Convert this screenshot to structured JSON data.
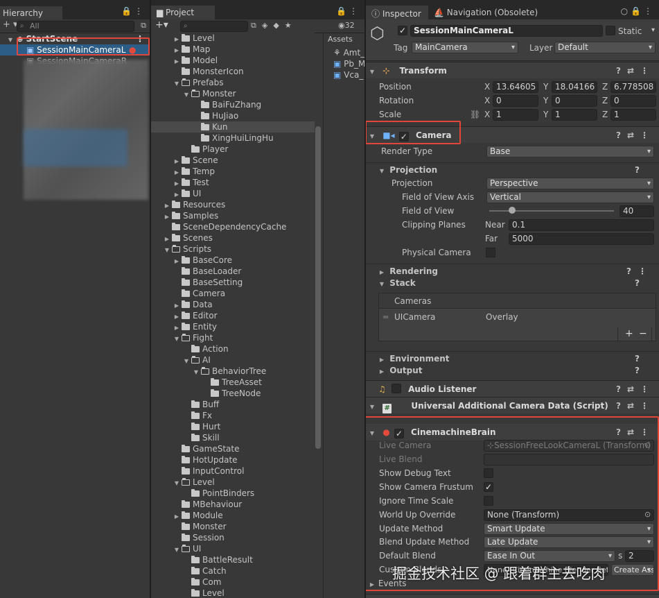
{
  "hierarchy": {
    "tab": "Hierarchy",
    "search_placeholder": "All",
    "scene": "StartScene",
    "selected": "SessionMainCameraL",
    "second": "SessionMainCameraR"
  },
  "project": {
    "tab": "Project",
    "count": "32",
    "assets_label": "Assets",
    "tree": [
      {
        "d": 2,
        "f": 1,
        "o": 0,
        "t": "Level"
      },
      {
        "d": 2,
        "f": 1,
        "o": 0,
        "t": "Map"
      },
      {
        "d": 2,
        "f": 1,
        "o": 0,
        "t": "Model"
      },
      {
        "d": 2,
        "f": 0,
        "o": 0,
        "t": "MonsterIcon"
      },
      {
        "d": 2,
        "f": 1,
        "o": 1,
        "t": "Prefabs"
      },
      {
        "d": 3,
        "f": 1,
        "o": 1,
        "t": "Monster"
      },
      {
        "d": 4,
        "f": 0,
        "o": 0,
        "t": "BaiFuZhang"
      },
      {
        "d": 4,
        "f": 0,
        "o": 0,
        "t": "HuJiao"
      },
      {
        "d": 4,
        "f": 0,
        "o": 0,
        "t": "Kun",
        "sel": 1
      },
      {
        "d": 4,
        "f": 0,
        "o": 0,
        "t": "XingHuiLingHu"
      },
      {
        "d": 3,
        "f": 0,
        "o": 0,
        "t": "Player"
      },
      {
        "d": 2,
        "f": 1,
        "o": 0,
        "t": "Scene"
      },
      {
        "d": 2,
        "f": 1,
        "o": 0,
        "t": "Temp"
      },
      {
        "d": 2,
        "f": 1,
        "o": 0,
        "t": "Test"
      },
      {
        "d": 2,
        "f": 1,
        "o": 0,
        "t": "UI"
      },
      {
        "d": 1,
        "f": 1,
        "o": 0,
        "t": "Resources"
      },
      {
        "d": 1,
        "f": 1,
        "o": 0,
        "t": "Samples"
      },
      {
        "d": 1,
        "f": 0,
        "o": 0,
        "t": "SceneDependencyCache"
      },
      {
        "d": 1,
        "f": 1,
        "o": 0,
        "t": "Scenes"
      },
      {
        "d": 1,
        "f": 1,
        "o": 1,
        "t": "Scripts"
      },
      {
        "d": 2,
        "f": 1,
        "o": 0,
        "t": "BaseCore"
      },
      {
        "d": 2,
        "f": 0,
        "o": 0,
        "t": "BaseLoader"
      },
      {
        "d": 2,
        "f": 0,
        "o": 0,
        "t": "BaseSetting"
      },
      {
        "d": 2,
        "f": 0,
        "o": 0,
        "t": "Camera"
      },
      {
        "d": 2,
        "f": 1,
        "o": 0,
        "t": "Data"
      },
      {
        "d": 2,
        "f": 1,
        "o": 0,
        "t": "Editor"
      },
      {
        "d": 2,
        "f": 1,
        "o": 0,
        "t": "Entity"
      },
      {
        "d": 2,
        "f": 1,
        "o": 1,
        "t": "Fight"
      },
      {
        "d": 3,
        "f": 0,
        "o": 0,
        "t": "Action"
      },
      {
        "d": 3,
        "f": 1,
        "o": 1,
        "t": "AI"
      },
      {
        "d": 4,
        "f": 1,
        "o": 1,
        "t": "BehaviorTree"
      },
      {
        "d": 5,
        "f": 0,
        "o": 0,
        "t": "TreeAsset"
      },
      {
        "d": 5,
        "f": 0,
        "o": 0,
        "t": "TreeNode"
      },
      {
        "d": 3,
        "f": 0,
        "o": 0,
        "t": "Buff"
      },
      {
        "d": 3,
        "f": 0,
        "o": 0,
        "t": "Fx"
      },
      {
        "d": 3,
        "f": 0,
        "o": 0,
        "t": "Hurt"
      },
      {
        "d": 3,
        "f": 0,
        "o": 0,
        "t": "Skill"
      },
      {
        "d": 2,
        "f": 0,
        "o": 0,
        "t": "GameState"
      },
      {
        "d": 2,
        "f": 0,
        "o": 0,
        "t": "HotUpdate"
      },
      {
        "d": 2,
        "f": 0,
        "o": 0,
        "t": "InputControl"
      },
      {
        "d": 2,
        "f": 1,
        "o": 1,
        "t": "Level"
      },
      {
        "d": 3,
        "f": 0,
        "o": 0,
        "t": "PointBinders"
      },
      {
        "d": 2,
        "f": 0,
        "o": 0,
        "t": "MBehaviour"
      },
      {
        "d": 2,
        "f": 1,
        "o": 0,
        "t": "Module"
      },
      {
        "d": 2,
        "f": 0,
        "o": 0,
        "t": "Monster"
      },
      {
        "d": 2,
        "f": 0,
        "o": 0,
        "t": "Session"
      },
      {
        "d": 2,
        "f": 1,
        "o": 1,
        "t": "UI"
      },
      {
        "d": 3,
        "f": 0,
        "o": 0,
        "t": "BattleResult"
      },
      {
        "d": 3,
        "f": 0,
        "o": 0,
        "t": "Catch"
      },
      {
        "d": 3,
        "f": 0,
        "o": 0,
        "t": "Com"
      },
      {
        "d": 3,
        "f": 0,
        "o": 0,
        "t": "Level"
      }
    ],
    "assets": [
      "Amt_",
      "Pb_M",
      "Vca_"
    ]
  },
  "inspector": {
    "tab": "Inspector",
    "tab2": "Navigation (Obsolete)",
    "object_name": "SessionMainCameraL",
    "static_label": "Static",
    "tag_label": "Tag",
    "tag_value": "MainCamera",
    "layer_label": "Layer",
    "layer_value": "Default",
    "transform": {
      "title": "Transform",
      "position_label": "Position",
      "rotation_label": "Rotation",
      "scale_label": "Scale",
      "px": "13.64605",
      "py": "18.04166",
      "pz": "6.778508",
      "rx": "0",
      "ry": "0",
      "rz": "0",
      "sx": "1",
      "sy": "1",
      "sz": "1"
    },
    "camera": {
      "title": "Camera",
      "render_type_label": "Render Type",
      "render_type": "Base",
      "projection_header": "Projection",
      "projection_label": "Projection",
      "projection": "Perspective",
      "fov_axis_label": "Field of View Axis",
      "fov_axis": "Vertical",
      "fov_label": "Field of View",
      "fov": "40",
      "clip_label": "Clipping Planes",
      "near_label": "Near",
      "near": "0.1",
      "far_label": "Far",
      "far": "5000",
      "physical_label": "Physical Camera",
      "rendering_header": "Rendering",
      "stack_header": "Stack",
      "cameras_label": "Cameras",
      "ui_camera": "UICamera",
      "ui_camera_type": "Overlay",
      "environment_header": "Environment",
      "output_header": "Output"
    },
    "audio": {
      "title": "Audio Listener"
    },
    "urp": {
      "title": "Universal Additional Camera Data (Script)"
    },
    "brain": {
      "title": "CinemachineBrain",
      "live_camera_label": "Live Camera",
      "live_camera": "SessionFreeLookCameraL (Transform)",
      "live_blend_label": "Live Blend",
      "debug_label": "Show Debug Text",
      "frustum_label": "Show Camera Frustum",
      "ignore_label": "Ignore Time Scale",
      "world_up_label": "World Up Override",
      "world_up": "None (Transform)",
      "update_method_label": "Update Method",
      "update_method": "Smart Update",
      "blend_update_label": "Blend Update Method",
      "blend_update": "Late Update",
      "default_blend_label": "Default Blend",
      "default_blend": "Ease In Out",
      "blend_s": "s",
      "blend_time": "2",
      "custom_label": "Custom Blends",
      "custom_value": "None (Cinemachine Blender Settings)",
      "create_label": "Create Asset",
      "events_label": "Events"
    }
  },
  "watermark": "掘金技术社区 @ 跟着群主去吃肉"
}
